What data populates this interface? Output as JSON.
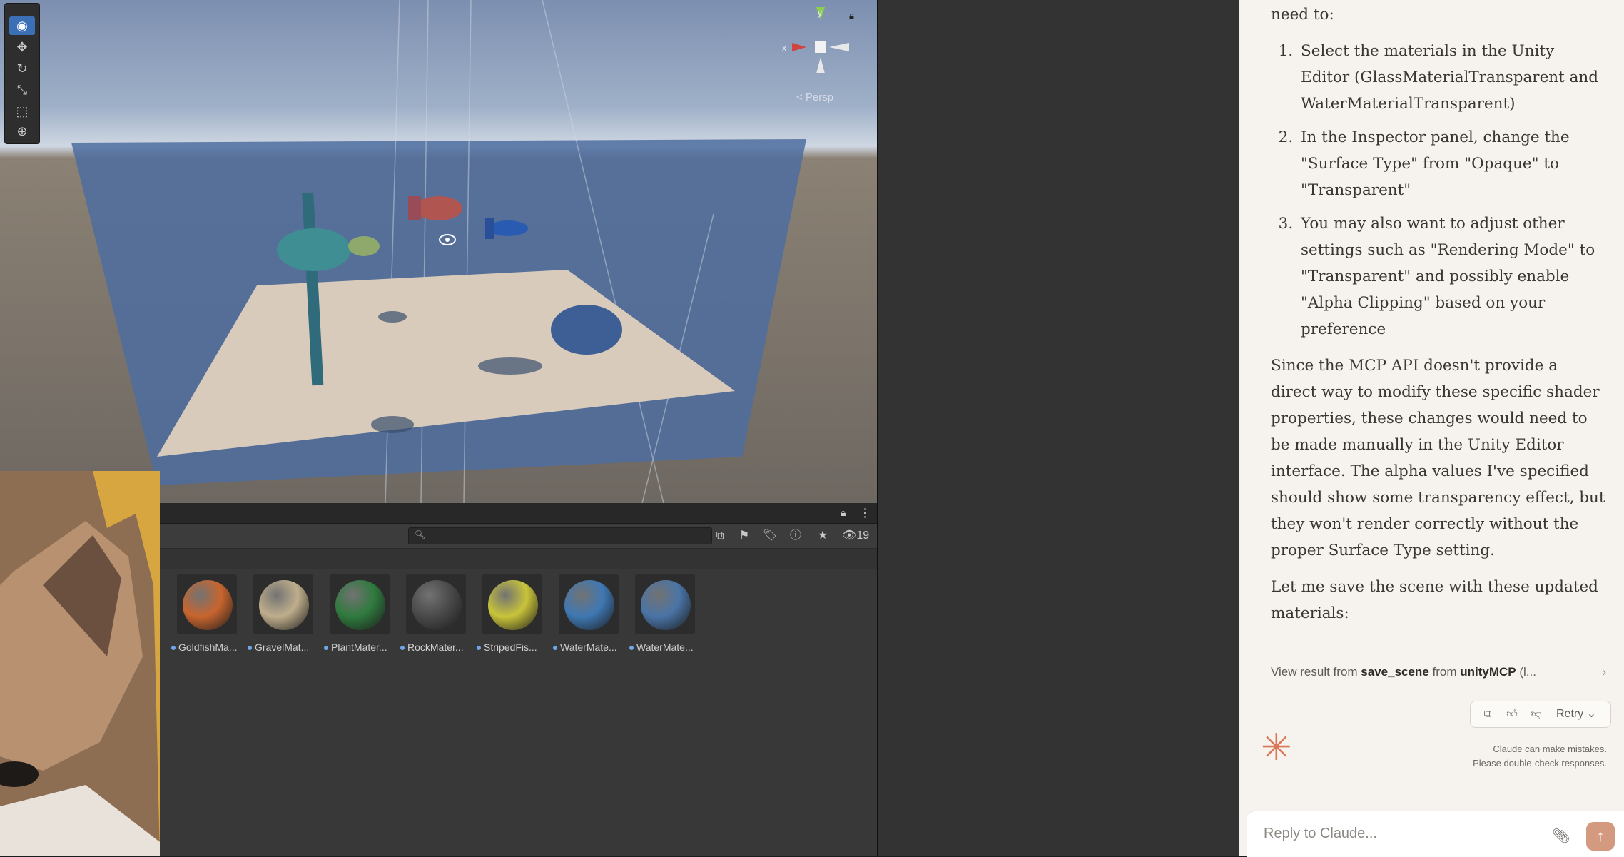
{
  "scene": {
    "persp_label": "< Persp",
    "gizmo_axes": {
      "x": "x",
      "y": "y"
    },
    "tools": [
      "view-tool",
      "move-tool",
      "rotate-tool",
      "scale-tool",
      "rect-tool",
      "transform-tool"
    ]
  },
  "project": {
    "hidden_count": "19",
    "search_placeholder": "",
    "assets": [
      {
        "label": "GoldfishMa...",
        "color": "#c8652e"
      },
      {
        "label": "GravelMat...",
        "color": "#bfae8c"
      },
      {
        "label": "PlantMater...",
        "color": "#2f7a3e"
      },
      {
        "label": "RockMater...",
        "color": "#4a4a4a"
      },
      {
        "label": "StripedFis...",
        "color": "#c9c43a"
      },
      {
        "label": "WaterMate...",
        "color": "#3f78b3"
      },
      {
        "label": "WaterMate...",
        "color": "#4a74a6"
      }
    ]
  },
  "chat": {
    "intro": "need to:",
    "steps": [
      "Select the materials in the Unity Editor (GlassMaterialTransparent and WaterMaterialTransparent)",
      "In the Inspector panel, change the \"Surface Type\" from \"Opaque\" to \"Transparent\"",
      "You may also want to adjust other settings such as \"Rendering Mode\" to \"Transparent\" and possibly enable \"Alpha Clipping\" based on your preference"
    ],
    "paragraph": "Since the MCP API doesn't provide a direct way to modify these specific shader properties, these changes would need to be made manually in the Unity Editor interface. The alpha values I've specified should show some transparency effect, but they won't render correctly without the proper Surface Type setting.",
    "closing": "Let me save the scene with these updated materials:",
    "tool_result": {
      "prefix": "View result from",
      "tool": "save_scene",
      "mid": "from",
      "server": "unityMCP",
      "suffix": "(l..."
    },
    "retry_label": "Retry",
    "disclaimer_1": "Claude can make mistakes.",
    "disclaimer_2": "Please double-check responses.",
    "reply_placeholder": "Reply to Claude...",
    "accent": "#d97757"
  }
}
